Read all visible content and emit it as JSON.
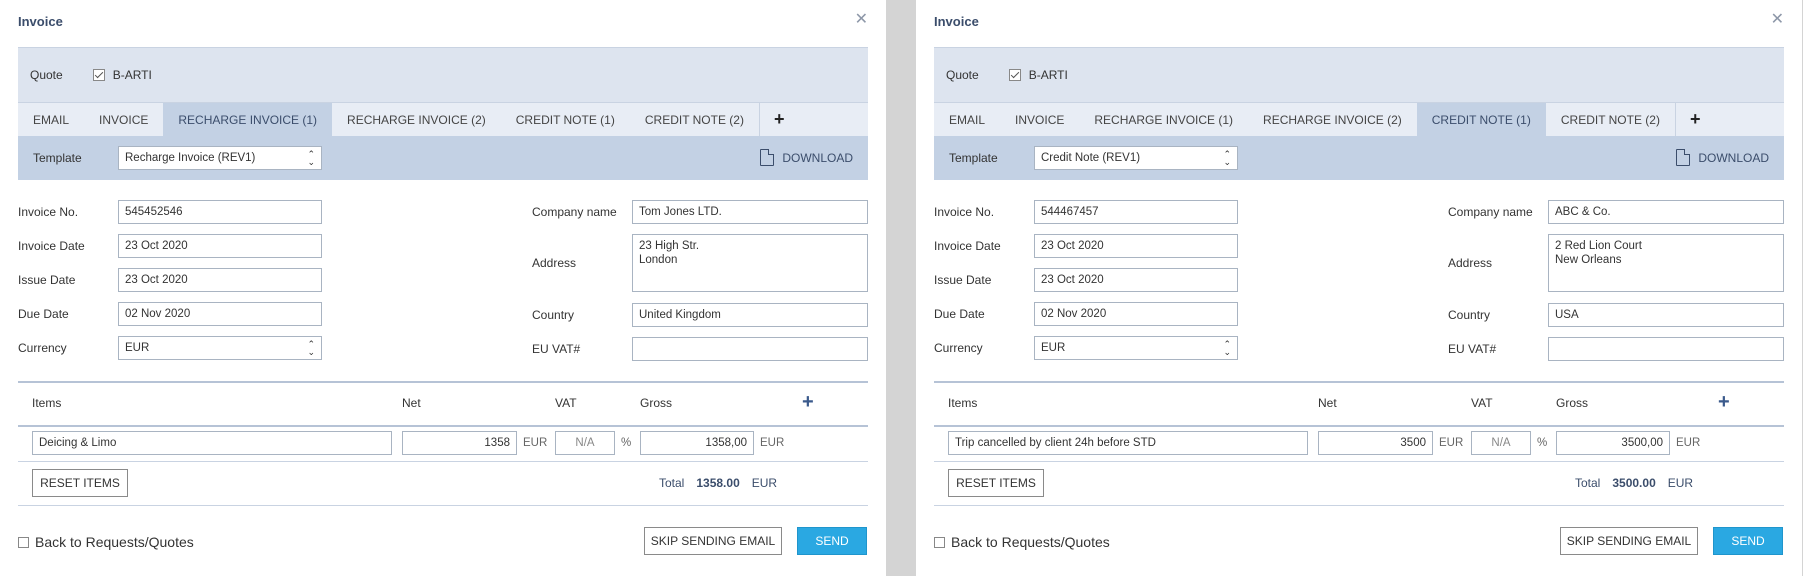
{
  "panels": [
    {
      "title": "Invoice",
      "quote_label": "Quote",
      "quote_ref": "B-ARTI",
      "tabs": [
        {
          "label": "EMAIL"
        },
        {
          "label": "INVOICE"
        },
        {
          "label": "RECHARGE INVOICE (1)"
        },
        {
          "label": "RECHARGE INVOICE (2)"
        },
        {
          "label": "CREDIT NOTE (1)"
        },
        {
          "label": "CREDIT NOTE (2)"
        }
      ],
      "active_tab": "RECHARGE INVOICE (1)",
      "template_label": "Template",
      "template_value": "Recharge Invoice (REV1)",
      "download_label": "DOWNLOAD",
      "invoice_no_label": "Invoice No.",
      "invoice_no": "545452546",
      "invoice_date_label": "Invoice Date",
      "invoice_date": "23 Oct 2020",
      "issue_date_label": "Issue Date",
      "issue_date": "23 Oct 2020",
      "due_date_label": "Due Date",
      "due_date": "02 Nov 2020",
      "currency_label": "Currency",
      "currency": "EUR",
      "company_label": "Company name",
      "company": "Tom Jones LTD.",
      "address_label": "Address",
      "address": "23 High Str.\nLondon",
      "country_label": "Country",
      "country": "United Kingdom",
      "vat_label": "EU VAT#",
      "vat": "",
      "col_items": "Items",
      "col_net": "Net",
      "col_vat": "VAT",
      "col_gross": "Gross",
      "item_desc": "Deicing & Limo",
      "item_net": "1358",
      "item_net_unit": "EUR",
      "item_vat_placeholder": "N/A",
      "item_vat_unit": "%",
      "item_gross": "1358,00",
      "item_gross_unit": "EUR",
      "reset_label": "RESET ITEMS",
      "total_label": "Total",
      "total_value": "1358.00",
      "total_currency": "EUR",
      "back_label": "Back to Requests/Quotes",
      "skip_label": "SKIP SENDING EMAIL",
      "send_label": "SEND"
    },
    {
      "title": "Invoice",
      "quote_label": "Quote",
      "quote_ref": "B-ARTI",
      "tabs": [
        {
          "label": "EMAIL"
        },
        {
          "label": "INVOICE"
        },
        {
          "label": "RECHARGE INVOICE (1)"
        },
        {
          "label": "RECHARGE INVOICE (2)"
        },
        {
          "label": "CREDIT NOTE (1)"
        },
        {
          "label": "CREDIT NOTE (2)"
        }
      ],
      "active_tab": "CREDIT NOTE (1)",
      "template_label": "Template",
      "template_value": "Credit Note (REV1)",
      "download_label": "DOWNLOAD",
      "invoice_no_label": "Invoice No.",
      "invoice_no": "544467457",
      "invoice_date_label": "Invoice Date",
      "invoice_date": "23 Oct 2020",
      "issue_date_label": "Issue Date",
      "issue_date": "23 Oct 2020",
      "due_date_label": "Due Date",
      "due_date": "02 Nov 2020",
      "currency_label": "Currency",
      "currency": "EUR",
      "company_label": "Company name",
      "company": "ABC & Co.",
      "address_label": "Address",
      "address": "2 Red Lion Court\nNew Orleans",
      "country_label": "Country",
      "country": "USA",
      "vat_label": "EU VAT#",
      "vat": "",
      "col_items": "Items",
      "col_net": "Net",
      "col_vat": "VAT",
      "col_gross": "Gross",
      "item_desc": "Trip cancelled by  client 24h before STD",
      "item_net": "3500",
      "item_net_unit": "EUR",
      "item_vat_placeholder": "N/A",
      "item_vat_unit": "%",
      "item_gross": "3500,00",
      "item_gross_unit": "EUR",
      "reset_label": "RESET ITEMS",
      "total_label": "Total",
      "total_value": "3500.00",
      "total_currency": "EUR",
      "back_label": "Back to Requests/Quotes",
      "skip_label": "SKIP SENDING EMAIL",
      "send_label": "SEND"
    }
  ],
  "colors": {
    "accent": "#2aa8e2",
    "header_bg": "#dde4ef",
    "template_bar_bg": "#c3d1e4",
    "title_text": "#3b4d6b"
  },
  "icons": [
    "close-icon",
    "checkbox-icon",
    "plus-icon",
    "pdf-icon",
    "chevron-updown-icon"
  ]
}
